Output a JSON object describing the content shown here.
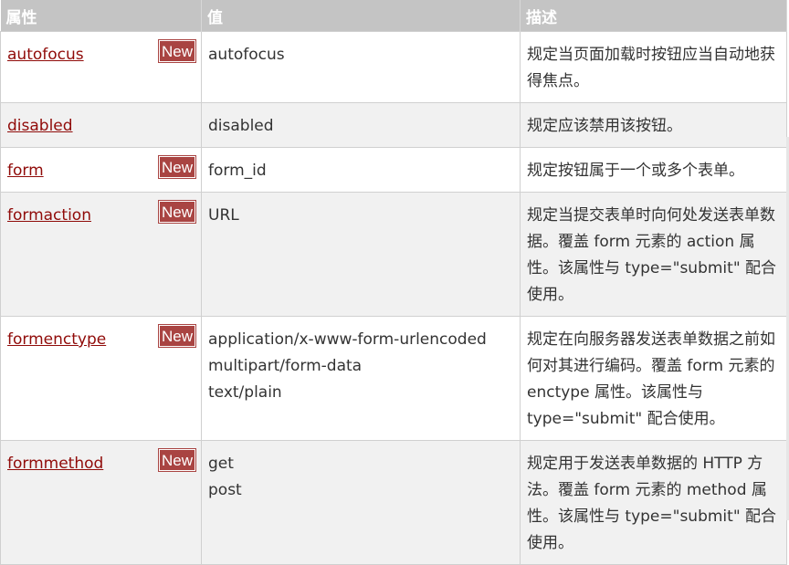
{
  "headers": {
    "attribute": "属性",
    "value": "值",
    "description": "描述"
  },
  "badge_label": "New",
  "rows": [
    {
      "attr": "autofocus",
      "is_new": true,
      "values": [
        "autofocus"
      ],
      "desc": "规定当页面加载时按钮应当自动地获得焦点。"
    },
    {
      "attr": "disabled",
      "is_new": false,
      "values": [
        "disabled"
      ],
      "desc": "规定应该禁用该按钮。"
    },
    {
      "attr": "form",
      "is_new": true,
      "values": [
        "form_id"
      ],
      "desc": "规定按钮属于一个或多个表单。"
    },
    {
      "attr": "formaction",
      "is_new": true,
      "values": [
        "URL"
      ],
      "desc": "规定当提交表单时向何处发送表单数据。覆盖 form 元素的 action 属性。该属性与 type=\"submit\" 配合使用。"
    },
    {
      "attr": "formenctype",
      "is_new": true,
      "values": [
        "application/x-www-form-urlencoded",
        "multipart/form-data",
        "text/plain"
      ],
      "desc": "规定在向服务器发送表单数据之前如何对其进行编码。覆盖 form 元素的 enctype 属性。该属性与 type=\"submit\" 配合使用。"
    },
    {
      "attr": "formmethod",
      "is_new": true,
      "values": [
        "get",
        "post"
      ],
      "desc": "规定用于发送表单数据的 HTTP 方法。覆盖 form 元素的 method 属性。该属性与 type=\"submit\" 配合使用。"
    }
  ]
}
